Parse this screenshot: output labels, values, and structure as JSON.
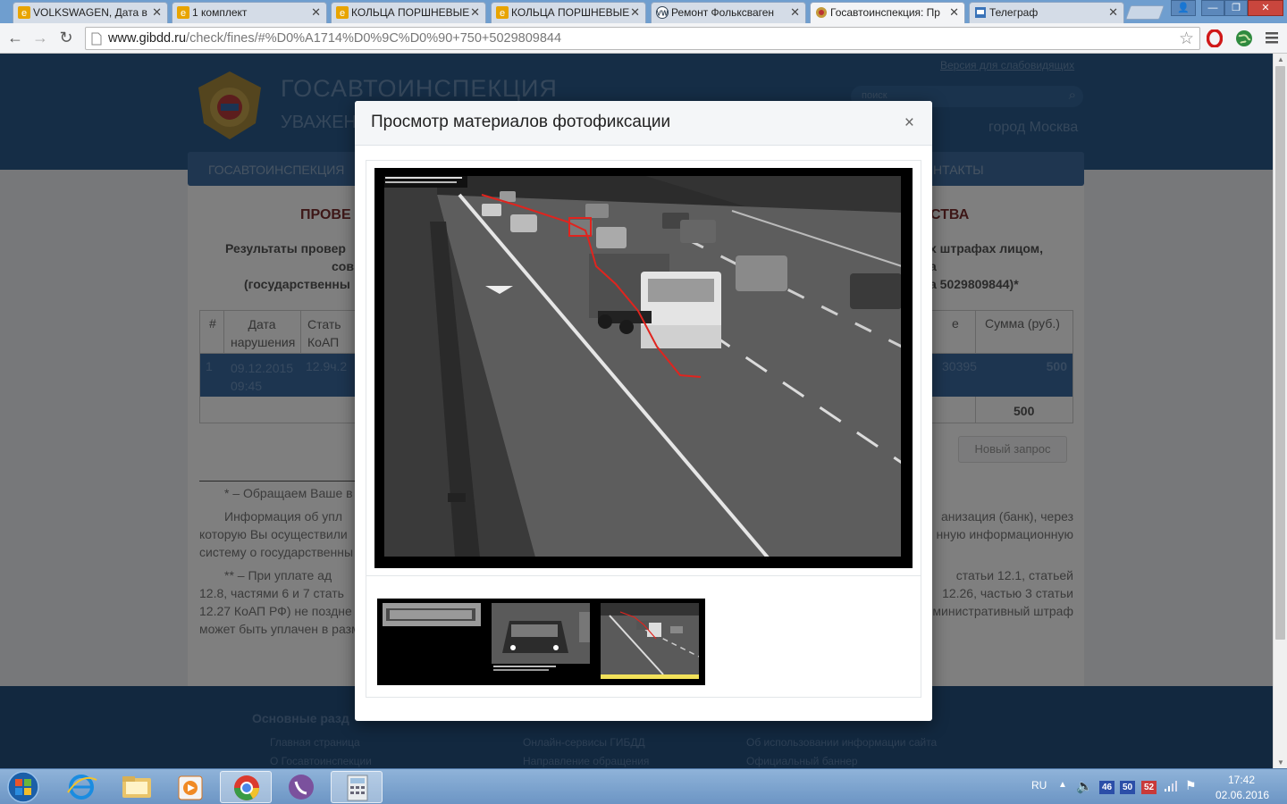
{
  "browser": {
    "tabs": [
      {
        "label": "VOLKSWAGEN, Дата в",
        "favicon": "ie-icon",
        "active": false
      },
      {
        "label": "1 комплект",
        "favicon": "ie-icon",
        "active": false
      },
      {
        "label": "КОЛЬЦА ПОРШНЕВЫЕ",
        "favicon": "ie-icon",
        "active": false
      },
      {
        "label": "КОЛЬЦА ПОРШНЕВЫЕ",
        "favicon": "ie-icon",
        "active": false
      },
      {
        "label": "Ремонт Фольксваген",
        "favicon": "vw-icon",
        "active": false
      },
      {
        "label": "Госавтоинспекция: Пр",
        "favicon": "gibdd-icon",
        "active": true
      },
      {
        "label": "Телеграф",
        "favicon": "telegraph-icon",
        "active": false
      }
    ],
    "address": {
      "domain": "www.gibdd.ru",
      "path": "/check/fines/#%D0%A1714%D0%9C%D0%90+750+5029809844"
    }
  },
  "site": {
    "brand": "ГОСАВТОИНСПЕКЦИЯ",
    "brand_sub": "УВАЖЕН",
    "accessible_link": "Версия для слабовидящих",
    "search_placeholder": "поиск",
    "city": "город Москва",
    "nav": [
      "ГОСАВТОИНСПЕКЦИЯ",
      "НТАКТЫ"
    ],
    "heading_left": "ПРОВЕ",
    "heading_right": "СТВА",
    "results_left": [
      "Результаты провер",
      "сов",
      "(государственны"
    ],
    "results_right": [
      "х штрафах лицом,",
      "а",
      "а 5029809844)*"
    ],
    "table": {
      "headers": [
        "#",
        "Дата нарушения",
        "Стать КоАП",
        "е",
        "Сумма (руб.)"
      ],
      "rows": [
        {
          "num": "1",
          "date": "09.12.2015 09:45",
          "article": "12.9ч.2",
          "id_tail": "30395",
          "amount": "500"
        }
      ],
      "total": "500"
    },
    "new_request": "Новый запрос",
    "notes_left": [
      "* – Обращаем Ваше в",
      "Информация об упл",
      "которую Вы осуществили",
      "систему о государственны",
      "** – При уплате ад",
      "12.8, частями 6 и 7 стать",
      "12.27 КоАП РФ) не поздне",
      "может быть уплачен в разм"
    ],
    "notes_right": [
      "анизация (банк), через",
      "нную информационную",
      "статьи 12.1, статьей",
      "12.26, частью 3 статьи",
      "министративный штраф"
    ],
    "footer": {
      "heading": "Основные разд",
      "col1": [
        "Главная страница",
        "О Госавтоинспекции"
      ],
      "col2": [
        "Онлайн-сервисы ГИБДД",
        "Направление обращения"
      ],
      "col3": [
        "Об использовании информации сайта",
        "Официальный баннер"
      ]
    }
  },
  "modal": {
    "title": "Просмотр материалов фотофиксации",
    "close": "×",
    "selected_thumb": 3,
    "thumbs": [
      "plate-thumbnail",
      "car-thumbnail",
      "road-thumbnail"
    ]
  },
  "taskbar": {
    "lang": "RU",
    "time": "17:42",
    "date": "02.06.2016",
    "badges": [
      "46",
      "50",
      "52"
    ]
  },
  "colors": {
    "site_blue": "#2a5a8c",
    "accent_red": "#c0392b",
    "taskbar": "#7aa3d0"
  }
}
